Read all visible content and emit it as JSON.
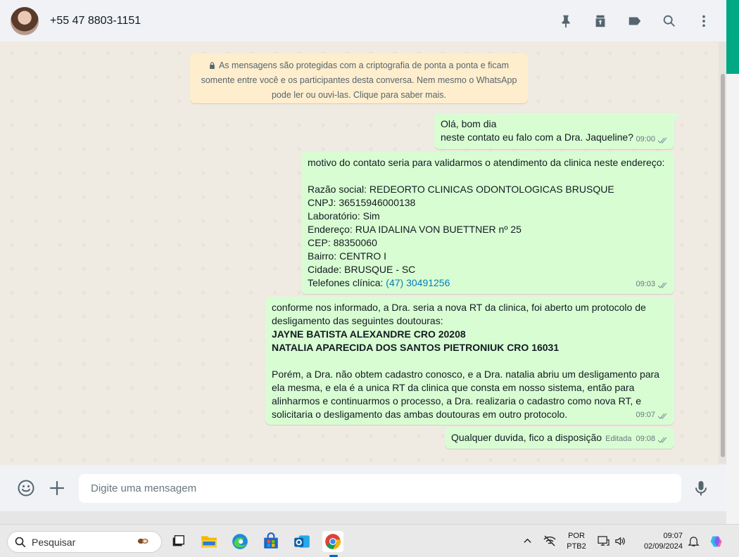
{
  "header": {
    "contact_name": "+55 47 8803-1151",
    "icons": [
      "pin-icon",
      "archive-icon",
      "label-icon",
      "search-icon",
      "menu-icon"
    ]
  },
  "encryption_notice": {
    "line1": "As mensagens são protegidas com a criptografia de ponta a ponta e ficam",
    "line2": "somente entre você e os participantes desta conversa. Nem mesmo o WhatsApp",
    "line3": "pode ler ou ouvi-las. Clique para saber mais."
  },
  "messages": [
    {
      "lines": [
        "Olá, bom dia",
        "neste contato eu falo com a Dra. Jaqueline?"
      ],
      "time": "09:00"
    },
    {
      "lines": [
        "motivo do contato seria para validarmos o atendimento da clinica neste endereço:",
        "",
        "Razão social: REDEORTO CLINICAS ODONTOLOGICAS BRUSQUE",
        "CNPJ: 36515946000138",
        "Laboratório: Sim",
        "Endereço: RUA IDALINA VON BUETTNER nº 25",
        "CEP: 88350060",
        "Bairro: CENTRO I",
        "Cidade: BRUSQUE - SC"
      ],
      "phone_label": "Telefones clínica: ",
      "phone_link": "(47) 30491256",
      "time": "09:03"
    },
    {
      "lines": [
        "conforme nos informado, a Dra. seria a nova RT da clinica, foi aberto um protocolo de",
        "desligamento das seguintes doutouras:"
      ],
      "bold_lines": [
        "JAYNE BATISTA ALEXANDRE CRO 20208",
        "NATALIA APARECIDA DOS SANTOS PIETRONIUK CRO 16031"
      ],
      "lines_after": [
        "",
        "Porém, a Dra. não obtem cadastro conosco, e a Dra. natalia abriu um desligamento para",
        "ela mesma, e ela é a unica RT da clinica que consta em nosso sistema, então para",
        "alinharmos e continuarmos o processo, a Dra. realizaria o cadastro como nova RT, e",
        "solicitaria o desligamento das ambas doutouras em outro protocolo."
      ],
      "time": "09:07"
    },
    {
      "lines": [
        "Qualquer duvida, fico a disposição"
      ],
      "edited_label": "Editada",
      "time": "09:08"
    }
  ],
  "composer": {
    "placeholder": "Digite uma mensagem"
  },
  "taskbar": {
    "search_label": "Pesquisar",
    "lang_line1": "POR",
    "lang_line2": "PTB2",
    "time": "09:07",
    "date": "02/09/2024"
  },
  "colors": {
    "outgoing_bubble": "#d9fdd3",
    "chat_background": "#efeae2",
    "notice_background": "#ffeecd",
    "accent": "#00a884",
    "link": "#027eb5"
  }
}
